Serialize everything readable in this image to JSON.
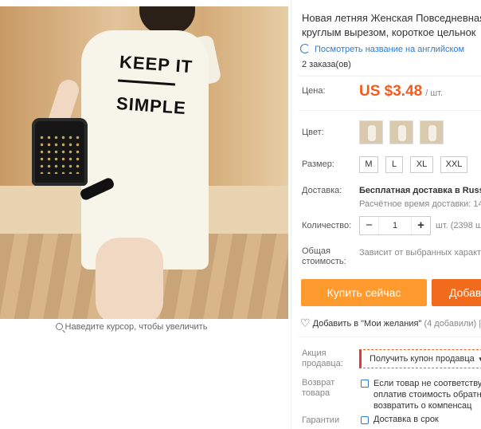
{
  "product": {
    "title_line1": "Новая летняя Женская Повседневная",
    "title_line2": "круглым вырезом, короткое цельнок",
    "translate_link": "Посмотреть название на английском",
    "orders": "2 заказа(ов)"
  },
  "gallery": {
    "zoom_hint": "Наведите курсор, чтобы увеличить",
    "photo_print_line1": "KEEP IT",
    "photo_print_line2": "SIMPLE"
  },
  "price": {
    "label": "Цена:",
    "value": "US $3.48",
    "unit": "/ шт."
  },
  "color": {
    "label": "Цвет:",
    "swatches": [
      "swatch-1",
      "swatch-2",
      "swatch-3"
    ]
  },
  "size": {
    "label": "Размер:",
    "options": [
      "M",
      "L",
      "XL",
      "XXL"
    ]
  },
  "shipping": {
    "label": "Доставка:",
    "main": "Бесплатная доставка в Russia",
    "sub": "Расчётное время доставки: 14"
  },
  "quantity": {
    "label": "Количество:",
    "minus": "−",
    "value": "1",
    "plus": "+",
    "note": "шт. (2398 ш"
  },
  "total": {
    "label_line1": "Общая",
    "label_line2": "стоимость:",
    "value": "Зависит от выбранных характе"
  },
  "actions": {
    "buy_now": "Купить сейчас",
    "add_to_cart": "Добав",
    "wishlist": "Добавить в \"Мои желания\"",
    "wishlist_count": "(4 добавили)",
    "wishlist_sep": "|"
  },
  "promo": {
    "label_line1": "Акция",
    "label_line2": "продавца:",
    "coupon": "Получить купон продавца",
    "caret": "▼"
  },
  "returns": {
    "label_line1": "Возврат",
    "label_line2": "товара",
    "line1": "Если товар не соответствуе",
    "line2": "оплатив стоимость обратно",
    "line3": "возвратить о компенсац"
  },
  "guarantee": {
    "label": "Гарантии",
    "text": "Доставка в срок"
  },
  "colors": {
    "accent_orange": "#ff9a2e",
    "accent_dark_orange": "#f26a1b",
    "price_red": "#f25c1f",
    "link_blue": "#2e7bcf"
  }
}
